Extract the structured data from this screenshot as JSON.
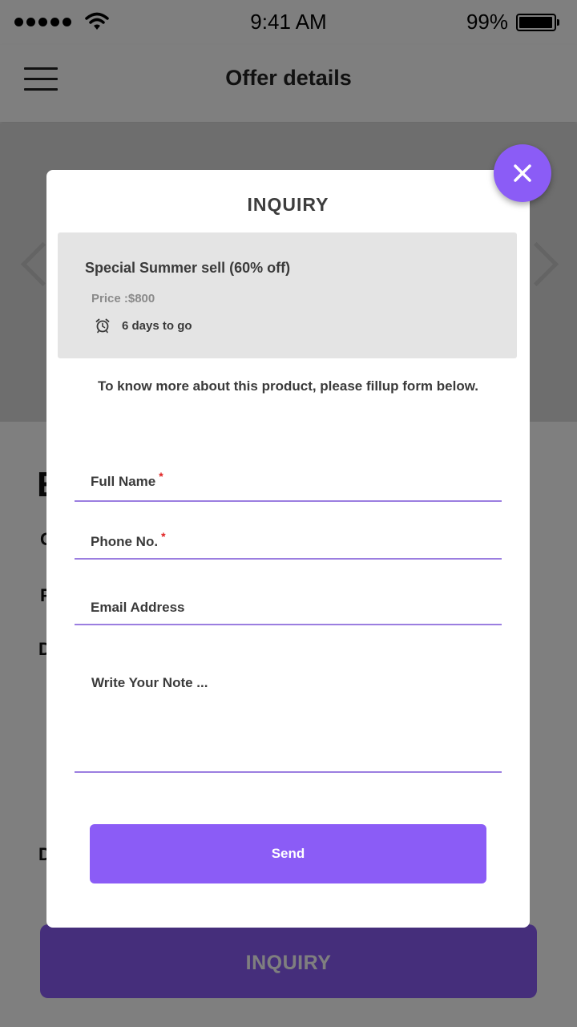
{
  "status_bar": {
    "time": "9:41 AM",
    "battery_percent": "99%",
    "signal_icon": "cellular-signal-dots-icon",
    "wifi_icon": "wifi-icon",
    "battery_icon": "battery-icon"
  },
  "header": {
    "title": "Offer details",
    "menu_icon": "hamburger-menu-icon"
  },
  "background": {
    "inquiry_button_label": "INQUIRY",
    "accent_color": "#8b5cf6"
  },
  "modal": {
    "title": "INQUIRY",
    "close_icon": "close-icon",
    "offer": {
      "title": "Special Summer sell (60% off)",
      "price": "Price :$800",
      "deadline": "6 days to go",
      "deadline_icon": "alarm-clock-icon"
    },
    "instruction": "To know more about this product, please fillup form below.",
    "form": {
      "full_name_label": "Full Name",
      "phone_label": "Phone No.",
      "email_label": "Email Address",
      "note_placeholder": "Write Your Note ...",
      "required_marker": "*"
    },
    "send_label": "Send"
  }
}
